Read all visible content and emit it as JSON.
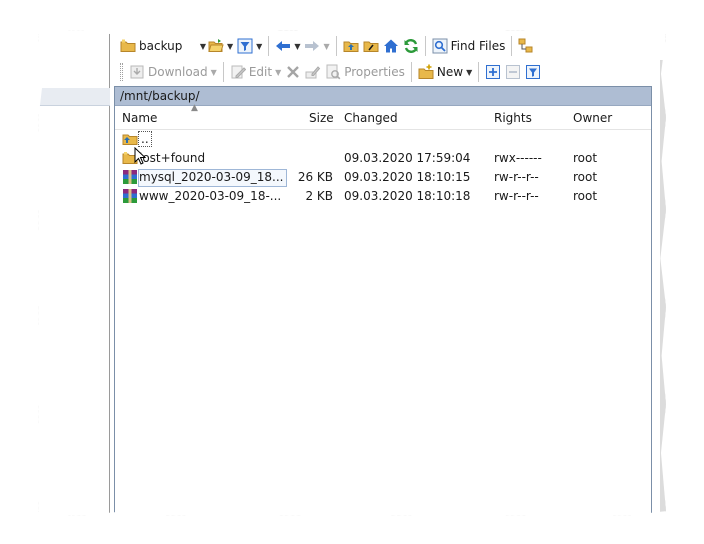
{
  "toolbar1": {
    "path_combo": "backup",
    "find_files": "Find Files"
  },
  "toolbar2": {
    "download": "Download",
    "edit": "Edit",
    "properties": "Properties",
    "new": "New"
  },
  "panel": {
    "path": "/mnt/backup/",
    "columns": [
      "Name",
      "Size",
      "Changed",
      "Rights",
      "Owner"
    ],
    "rows": [
      {
        "name": "..",
        "size": "",
        "changed": "",
        "rights": "",
        "owner": "",
        "icon": "parent-folder-icon"
      },
      {
        "name": "lost+found",
        "size": "",
        "changed": "09.03.2020 17:59:04",
        "rights": "rwx------",
        "owner": "root",
        "icon": "folder-icon"
      },
      {
        "name": "mysql_2020-03-09_18...",
        "size": "26 KB",
        "changed": "09.03.2020 18:10:15",
        "rights": "rw-r--r--",
        "owner": "root",
        "icon": "archive-icon"
      },
      {
        "name": "www_2020-03-09_18-...",
        "size": "2 KB",
        "changed": "09.03.2020 18:10:18",
        "rights": "rw-r--r--",
        "owner": "root",
        "icon": "archive-icon"
      }
    ]
  },
  "colors": {
    "path_bar": "#aebdd3",
    "folder": "#e8b84a",
    "accent_blue": "#2f6fd1",
    "accent_green": "#2c9a3a"
  }
}
